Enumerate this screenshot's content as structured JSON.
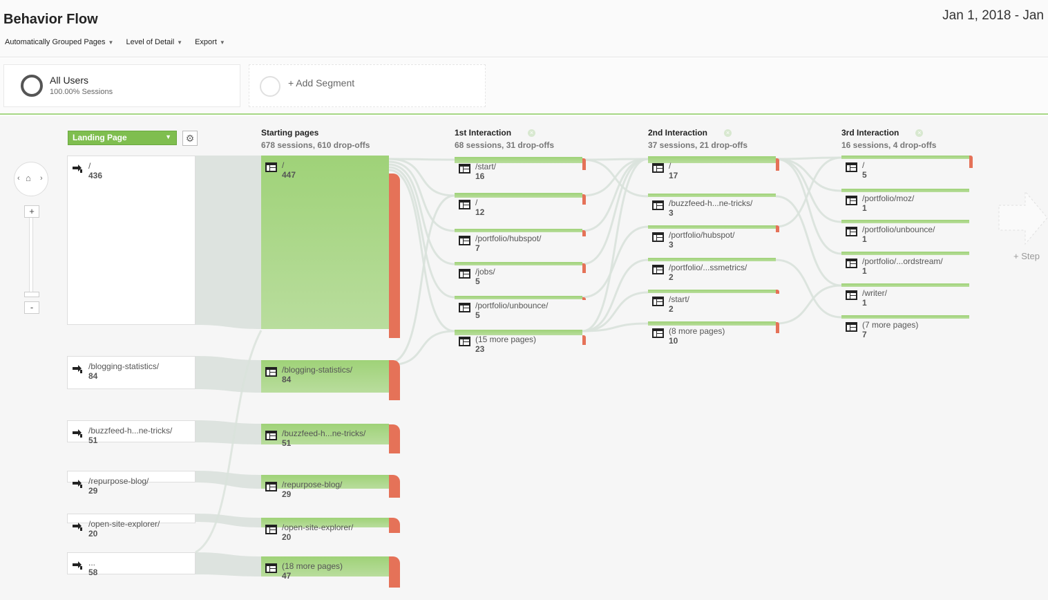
{
  "header": {
    "title": "Behavior Flow",
    "date_range": "Jan 1, 2018 - Jan",
    "toolbar": [
      {
        "label": "Automatically Grouped Pages"
      },
      {
        "label": "Level of Detail"
      },
      {
        "label": "Export"
      }
    ]
  },
  "segments": {
    "active": {
      "name": "All Users",
      "sub": "100.00% Sessions"
    },
    "add": {
      "label": "+ Add Segment"
    }
  },
  "flow": {
    "dimension": "Landing Page",
    "columns": [
      {
        "title": "Starting pages",
        "sub": "678 sessions, 610 drop-offs"
      },
      {
        "title": "1st Interaction",
        "sub": "68 sessions, 31 drop-offs"
      },
      {
        "title": "2nd Interaction",
        "sub": "37 sessions, 21 drop-offs"
      },
      {
        "title": "3rd Interaction",
        "sub": "16 sessions, 4 drop-offs"
      }
    ],
    "landing": [
      {
        "label": "/",
        "count": "436"
      },
      {
        "label": "/blogging-statistics/",
        "count": "84"
      },
      {
        "label": "/buzzfeed-h...ne-tricks/",
        "count": "51"
      },
      {
        "label": "/repurpose-blog/",
        "count": "29"
      },
      {
        "label": "/open-site-explorer/",
        "count": "20"
      },
      {
        "label": "...",
        "count": "58"
      }
    ],
    "starting": [
      {
        "label": "/",
        "count": "447"
      },
      {
        "label": "/blogging-statistics/",
        "count": "84"
      },
      {
        "label": "/buzzfeed-h...ne-tricks/",
        "count": "51"
      },
      {
        "label": "/repurpose-blog/",
        "count": "29"
      },
      {
        "label": "/open-site-explorer/",
        "count": "20"
      },
      {
        "label": "(18 more pages)",
        "count": "47"
      }
    ],
    "first": [
      {
        "label": "/start/",
        "count": "16"
      },
      {
        "label": "/",
        "count": "12"
      },
      {
        "label": "/portfolio/hubspot/",
        "count": "7"
      },
      {
        "label": "/jobs/",
        "count": "5"
      },
      {
        "label": "/portfolio/unbounce/",
        "count": "5"
      },
      {
        "label": "(15 more pages)",
        "count": "23"
      }
    ],
    "second": [
      {
        "label": "/",
        "count": "17"
      },
      {
        "label": "/buzzfeed-h...ne-tricks/",
        "count": "3"
      },
      {
        "label": "/portfolio/hubspot/",
        "count": "3"
      },
      {
        "label": "/portfolio/...ssmetrics/",
        "count": "2"
      },
      {
        "label": "/start/",
        "count": "2"
      },
      {
        "label": "(8 more pages)",
        "count": "10"
      }
    ],
    "third": [
      {
        "label": "/",
        "count": "5"
      },
      {
        "label": "/portfolio/moz/",
        "count": "1"
      },
      {
        "label": "/portfolio/unbounce/",
        "count": "1"
      },
      {
        "label": "/portfolio/...ordstream/",
        "count": "1"
      },
      {
        "label": "/writer/",
        "count": "1"
      },
      {
        "label": "(7 more pages)",
        "count": "7"
      }
    ],
    "next_step_label": "+ Step"
  },
  "colors": {
    "accent": "#7fbe4f",
    "page_green": "#9fd278",
    "drop_red": "#e57258",
    "link": "#d9e2db"
  }
}
